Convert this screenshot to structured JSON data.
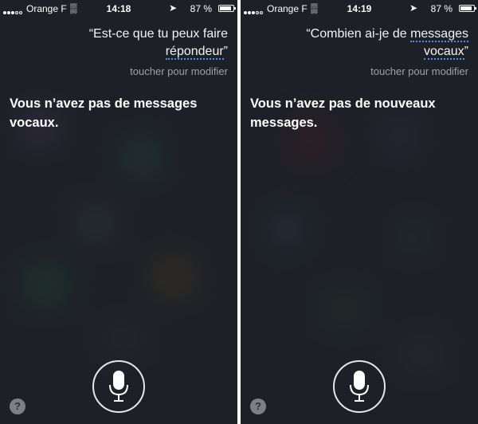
{
  "screens": [
    {
      "status": {
        "carrier": "Orange F",
        "time": "14:18",
        "battery": "87 %"
      },
      "query": {
        "text_before": "“Est-ce que tu peux faire ",
        "text_underlined": "répondeur",
        "text_after": "”"
      },
      "edit_hint": "toucher pour modifier",
      "answer": "Vous n’avez pas de messages vocaux."
    },
    {
      "status": {
        "carrier": "Orange F",
        "time": "14:19",
        "battery": "87 %"
      },
      "query": {
        "text_before": "“Combien ai-je de ",
        "text_underlined": "messages vocaux",
        "text_after": "”"
      },
      "edit_hint": "toucher pour modifier",
      "answer": "Vous n’avez pas de nouveaux messages."
    }
  ],
  "icons": {
    "mic": "microphone-icon",
    "help": "question-mark-icon",
    "location": "location-arrow-icon",
    "wifi": "wifi-icon"
  },
  "help_label": "?",
  "colors": {
    "background": "#2a2d35",
    "link_underline": "#4a8fe7",
    "hint": "#9da0a6"
  }
}
